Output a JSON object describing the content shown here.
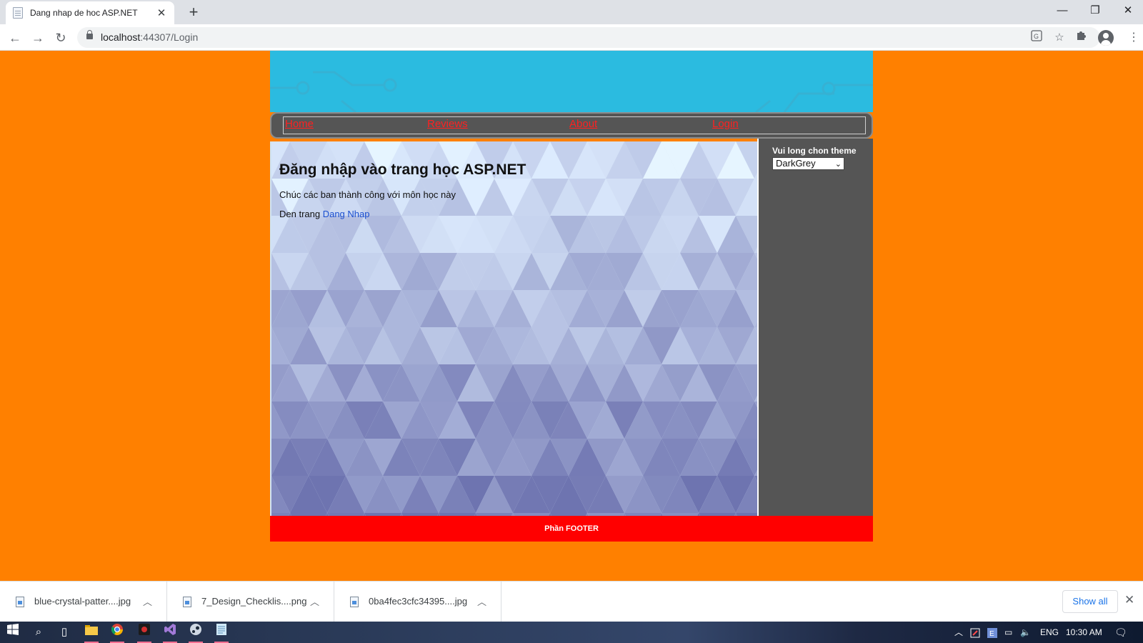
{
  "browser": {
    "tab_title": "Dang nhap de hoc ASP.NET",
    "tab_close": "✕",
    "new_tab": "+",
    "url_host": "localhost",
    "url_path": ":44307/Login",
    "window": {
      "minimize": "—",
      "restore": "❐",
      "close": "✕"
    },
    "nav": {
      "back": "←",
      "forward": "→",
      "reload": "↻"
    }
  },
  "page": {
    "nav_links": [
      "Home",
      "Reviews",
      "About",
      "Login"
    ],
    "heading": "Đăng nhập vào trang học ASP.NET",
    "subtitle": "Chúc các ban thành công với môn học này",
    "link_prefix": "Den trang ",
    "link_text": "Dang Nhap",
    "sidebar": {
      "label": "Vui long chon theme",
      "selected_theme": "DarkGrey"
    },
    "footer": "Phần FOOTER",
    "colors": {
      "page_bg": "#ff8000",
      "header": "#2bbbe0",
      "nav_link": "#ff2020",
      "sidebar": "#555555",
      "footer": "#ff0000"
    }
  },
  "downloads": {
    "items": [
      "blue-crystal-patter....jpg",
      "7_Design_Checklis....png",
      "0ba4fec3cfc34395....jpg"
    ],
    "show_all": "Show all",
    "close": "✕"
  },
  "taskbar": {
    "language": "ENG",
    "time": "10:30 AM"
  }
}
